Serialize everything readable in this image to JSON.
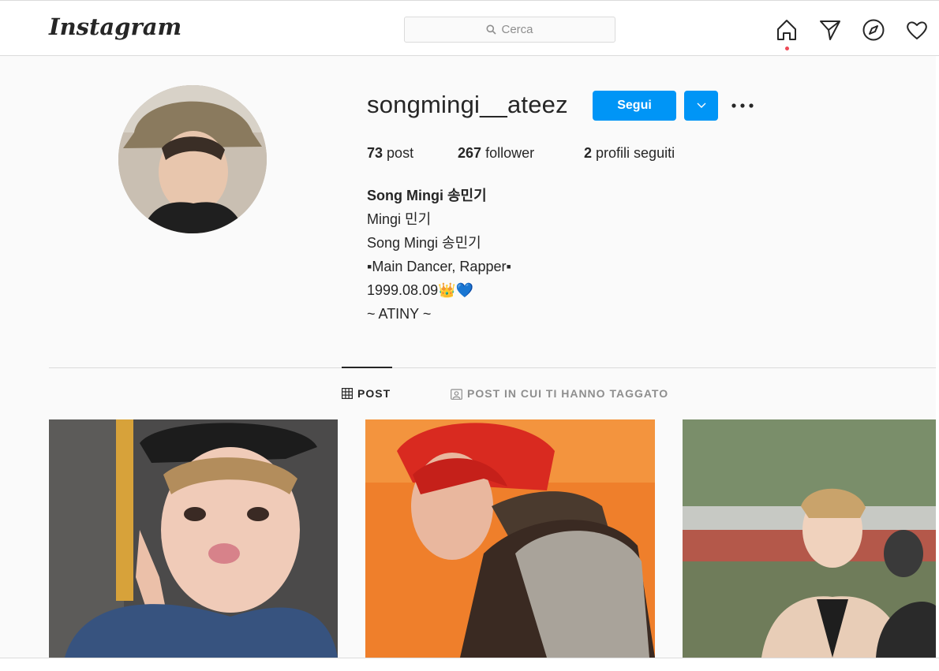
{
  "nav": {
    "logo": "Instagram",
    "search_placeholder": "Cerca",
    "icons": [
      "home-icon",
      "direct-icon",
      "explore-icon",
      "activity-heart-icon"
    ],
    "notification_dot_color": "#ed4956"
  },
  "profile": {
    "username": "songmingi__ateez",
    "follow_label": "Segui",
    "accent_color": "#0095f6",
    "stats": {
      "posts_count": "73",
      "posts_label": "post",
      "followers_count": "267",
      "followers_label": "follower",
      "following_count": "2",
      "following_label": "profili seguiti"
    },
    "bio": {
      "full_name": "Song Mingi 송민기",
      "lines": [
        "Mingi 민기",
        "Song Mingi 송민기",
        "▪Main Dancer, Rapper▪",
        "1999.08.09👑💙",
        "~ ATINY ~"
      ]
    }
  },
  "tabs": [
    {
      "label": "POST",
      "active": true,
      "icon": "grid-icon"
    },
    {
      "label": "POST IN CUI TI HANNO TAGGATO",
      "active": false,
      "icon": "tagged-icon"
    }
  ],
  "posts": [
    {
      "description": "selfie-denim-jacket"
    },
    {
      "description": "red-hair-orange-background"
    },
    {
      "description": "outdoor-beige-blazer"
    }
  ]
}
